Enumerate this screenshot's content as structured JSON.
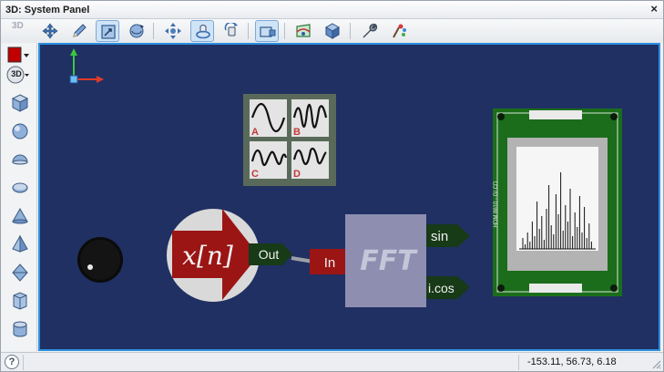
{
  "window": {
    "title": "3D: System Panel",
    "close_label": "×"
  },
  "toolbar": {
    "badge_3d": "3D",
    "buttons": [
      {
        "name": "move-tool",
        "icon": "move-arrows-icon"
      },
      {
        "name": "pencil-tool",
        "icon": "pencil-icon"
      },
      {
        "name": "select-tool",
        "icon": "select-box-icon",
        "active": true
      },
      {
        "name": "rotate-tool",
        "icon": "rotate-sphere-icon"
      },
      {
        "name": "pan-tool",
        "icon": "pan-arrows-icon"
      },
      {
        "name": "orbit-tool",
        "icon": "orbit-icon",
        "active": true
      },
      {
        "name": "spin-tool",
        "icon": "spin-icon"
      },
      {
        "name": "view-panel-tool",
        "icon": "panel-view-icon",
        "active": true
      },
      {
        "name": "mesh-tool",
        "icon": "mesh-icon"
      },
      {
        "name": "cube-view-tool",
        "icon": "cube-icon"
      },
      {
        "name": "wrench-tool",
        "icon": "wrench-icon"
      },
      {
        "name": "paint-tool",
        "icon": "paint-icon"
      }
    ]
  },
  "sidebar": {
    "color_swatch": "#c00000",
    "badge_3d": "3D",
    "shapes": [
      "cube-icon",
      "sphere-icon",
      "hemisphere-icon",
      "disc-icon",
      "cone-icon",
      "pyramid-icon",
      "octahedron-icon",
      "prism-icon",
      "cylinder-icon"
    ]
  },
  "scene": {
    "signal_label": "x[n]",
    "out_label": "Out",
    "in_label": "In",
    "fft_label": "FFT",
    "sin_label": "sin",
    "cos_label": "i.cos",
    "waveforms": [
      "A",
      "B",
      "C",
      "D"
    ],
    "lcd_text": "HDM 8610 - GLCD",
    "colors": {
      "background": "#203062",
      "block_red": "#9b1515",
      "block_green": "#173a17",
      "fft_box": "#8e8eb0",
      "board": "#1b6d1b"
    }
  },
  "status": {
    "help_label": "?",
    "coordinates": "-153.11, 56.73, 6.18"
  }
}
